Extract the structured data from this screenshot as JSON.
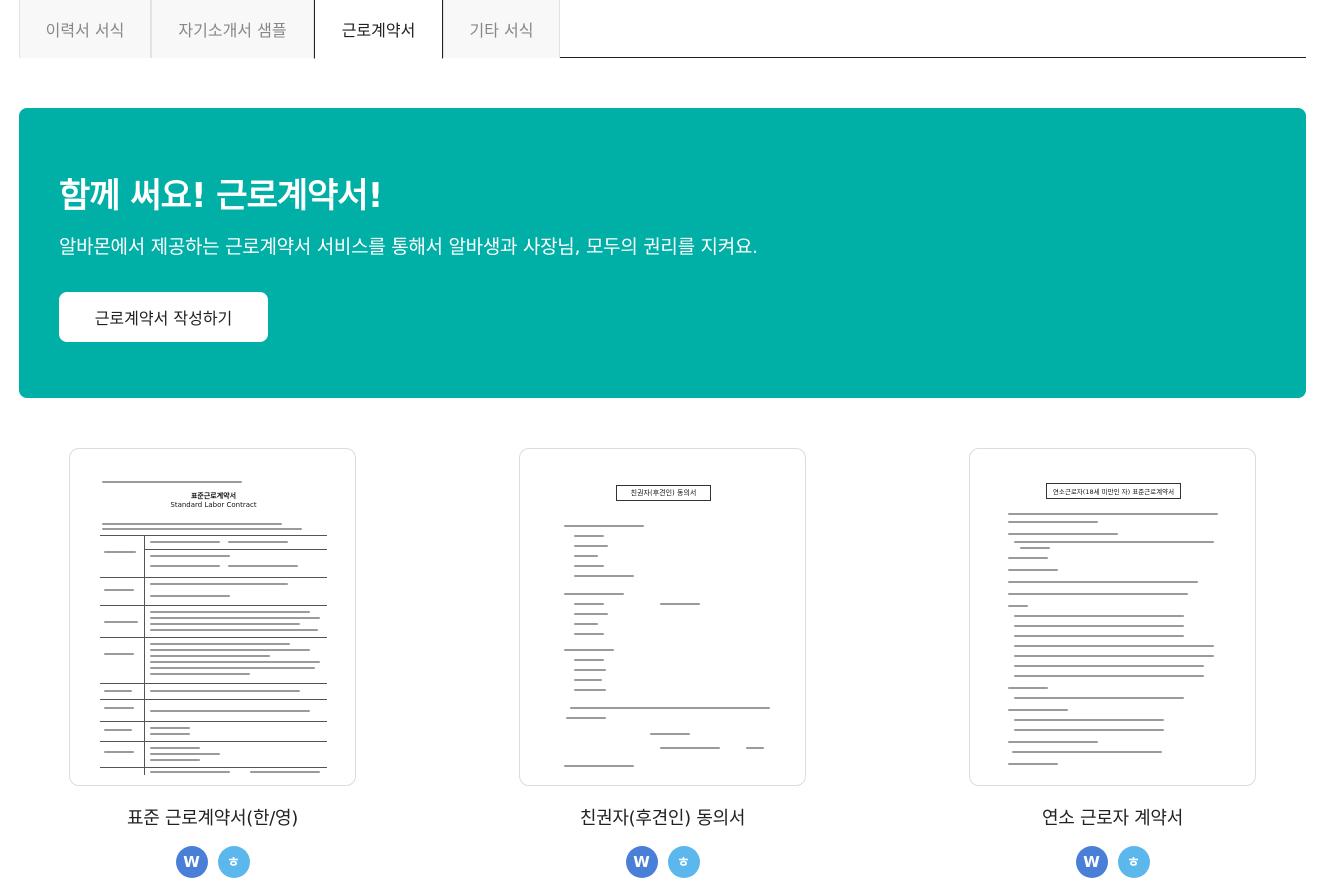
{
  "tabs": [
    {
      "label": "이력서 서식"
    },
    {
      "label": "자기소개서 샘플"
    },
    {
      "label": "근로계약서"
    },
    {
      "label": "기타 서식"
    }
  ],
  "active_tab": "근로계약서",
  "banner": {
    "title": "함께 써요! 근로계약서!",
    "subtitle": "알바몬에서 제공하는 근로계약서 서비스를 통해서 알바생과 사장님, 모두의 권리를 지켜요.",
    "button_label": "근로계약서 작성하기",
    "color": "#00afa6"
  },
  "cards": [
    {
      "title": "표준 근로계약서(한/영)",
      "doc_title": "표준근로계약서",
      "doc_subtitle": "Standard Labor Contract",
      "word_icon": "W",
      "hwp_icon": "ㅎ"
    },
    {
      "title": "친권자(후견인) 동의서",
      "doc_title": "친권자(후견인) 동의서",
      "word_icon": "W",
      "hwp_icon": "ㅎ"
    },
    {
      "title": "연소 근로자 계약서",
      "doc_title": "연소근로자(18세 미만인 자) 표준근로계약서",
      "word_icon": "W",
      "hwp_icon": "ㅎ"
    }
  ],
  "icon_colors": {
    "word": "#4a7fd8",
    "hwp": "#5bb7ec"
  }
}
